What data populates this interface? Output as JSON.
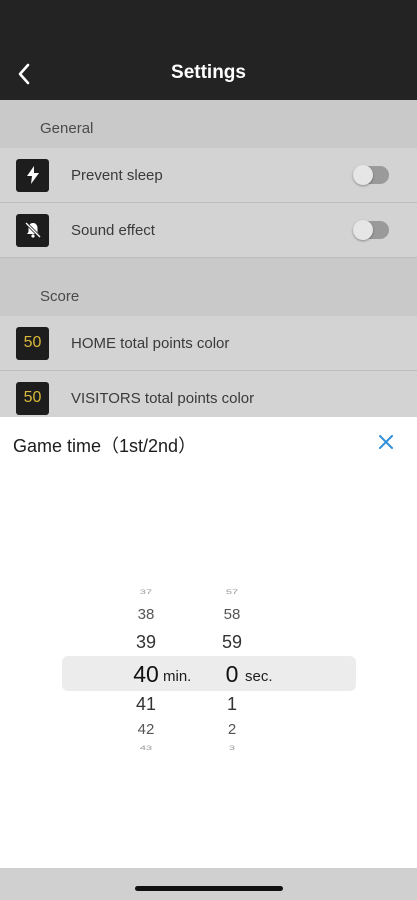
{
  "header": {
    "title": "Settings"
  },
  "general": {
    "section_label": "General",
    "items": [
      {
        "label": "Prevent sleep",
        "icon": "bolt-icon",
        "toggle": false
      },
      {
        "label": "Sound effect",
        "icon": "bell-slash-icon",
        "toggle": false
      }
    ]
  },
  "score": {
    "section_label": "Score",
    "items": [
      {
        "label": "HOME total points color",
        "badge": "50"
      },
      {
        "label": "VISITORS total points color",
        "badge": "50"
      }
    ]
  },
  "sheet": {
    "title": "Game time（1st/2nd）",
    "picker": {
      "minutes": {
        "above": [
          "37",
          "38",
          "39"
        ],
        "selected": "40",
        "below": [
          "41",
          "42",
          "43"
        ],
        "unit": "min."
      },
      "seconds": {
        "above": [
          "57",
          "58",
          "59"
        ],
        "selected": "0",
        "below": [
          "1",
          "2",
          "3"
        ],
        "unit": "sec."
      }
    }
  },
  "colors": {
    "accent": "#2f8fd8",
    "badge_text": "#d8b83a"
  }
}
